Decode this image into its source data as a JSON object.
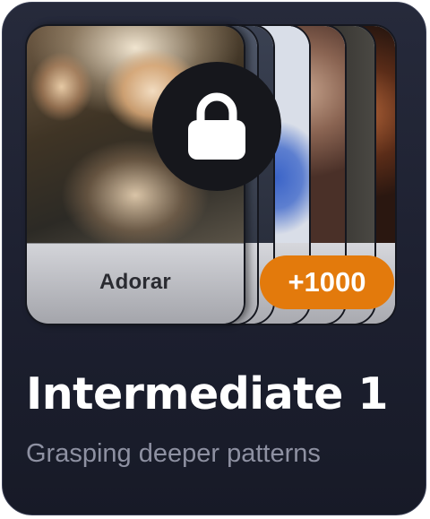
{
  "card": {
    "front_word": "Adorar",
    "lock_icon": "lock-icon",
    "badge_text": "+1000",
    "title": "Intermediate 1",
    "subtitle": "Grasping deeper patterns"
  },
  "colors": {
    "card_background": "#1d2030",
    "badge": "#e37a0c",
    "title": "#ffffff",
    "subtitle": "#8e91a2"
  }
}
